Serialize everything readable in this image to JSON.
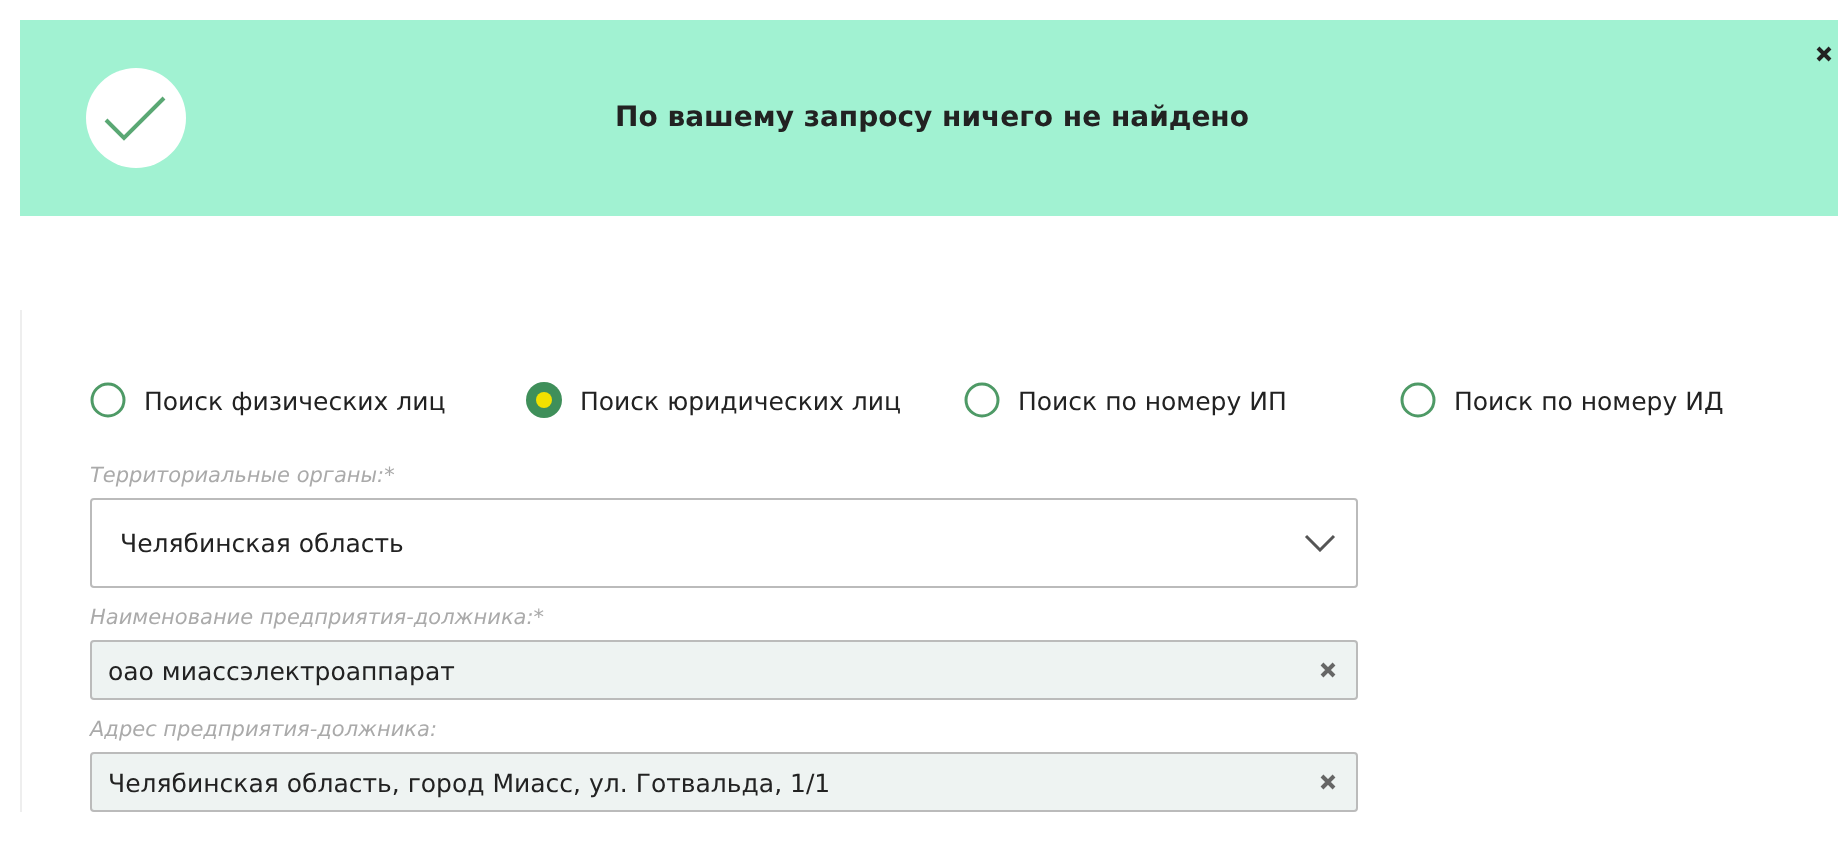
{
  "notice": {
    "message": "По вашему запросу ничего не найдено"
  },
  "search_modes": [
    {
      "label": "Поиск физических лиц",
      "selected": false
    },
    {
      "label": "Поиск юридических лиц",
      "selected": true
    },
    {
      "label": "Поиск по номеру ИП",
      "selected": false
    },
    {
      "label": "Поиск по номеру ИД",
      "selected": false
    }
  ],
  "fields": [
    {
      "kind": "select",
      "label": "Территориальные органы:*",
      "value": "Челябинская область"
    },
    {
      "kind": "text",
      "label": "Наименование предприятия-должника:*",
      "value": "оао миассэлектроаппарат"
    },
    {
      "kind": "text",
      "label": "Адрес предприятия-должника:",
      "value": "Челябинская область, город Миасс, ул. Готвальда, 1/1"
    }
  ]
}
